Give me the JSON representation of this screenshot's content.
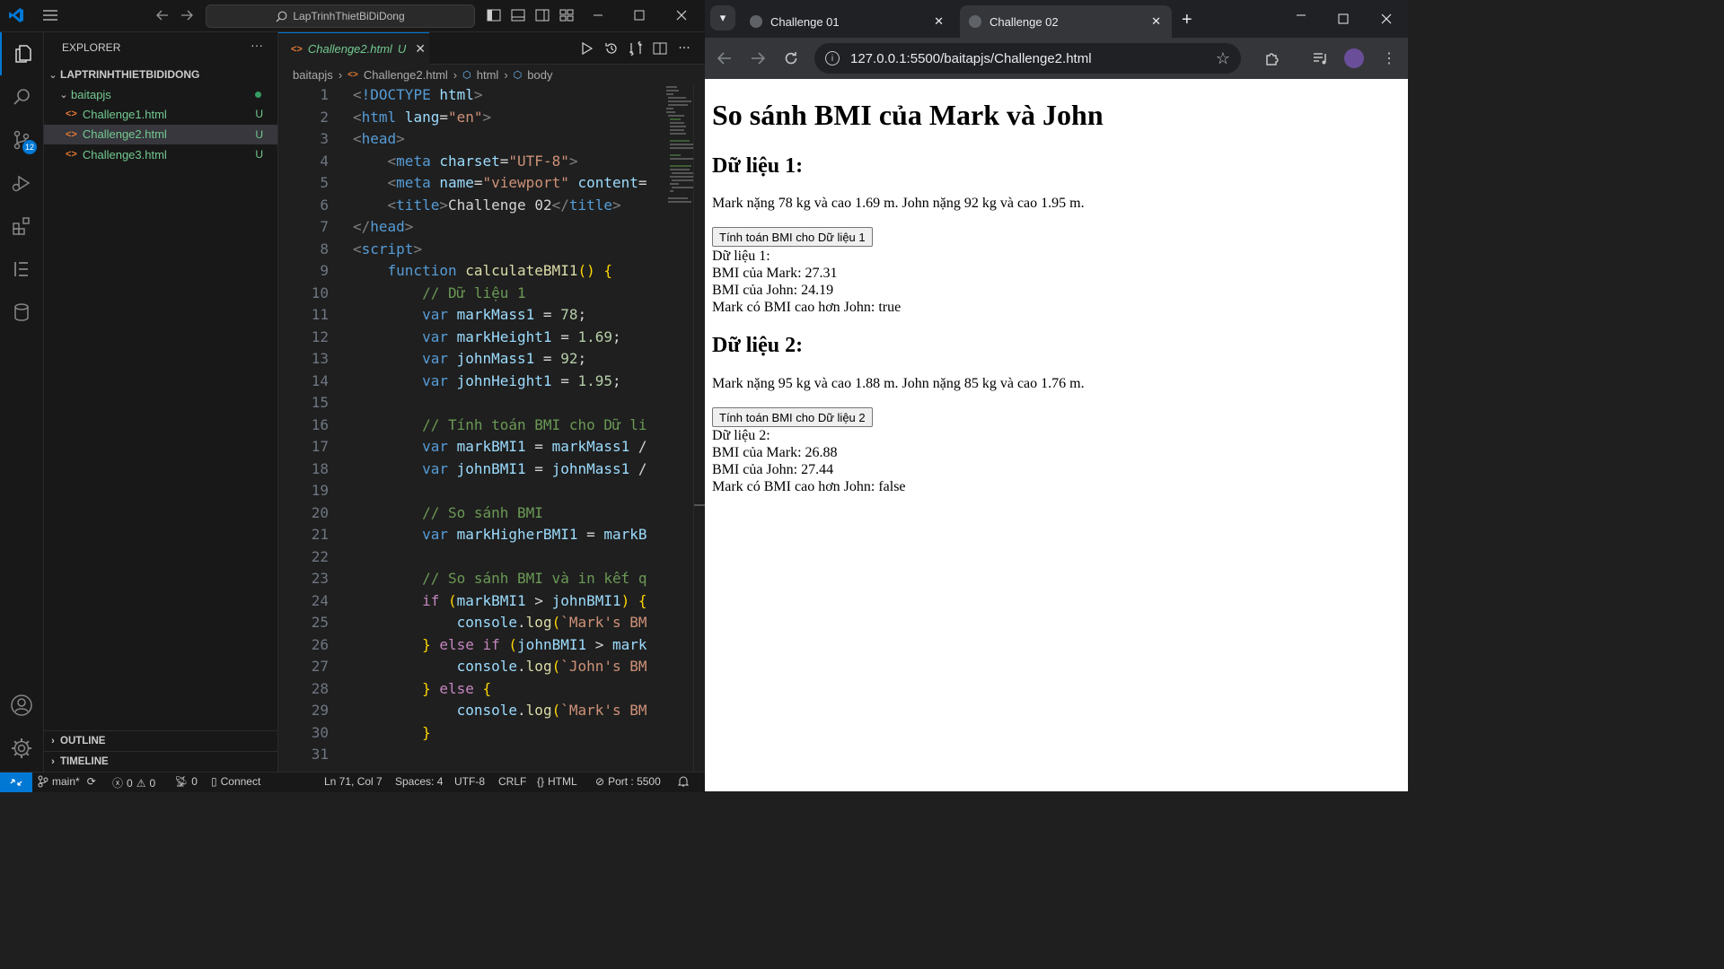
{
  "vscode": {
    "search_text": "LapTrinhThietBiDiDong",
    "explorer_title": "EXPLORER",
    "explorer_more": "···",
    "project_name": "LAPTRINHTHIETBIDIDONG",
    "folder_name": "baitapjs",
    "files": [
      {
        "name": "Challenge1.html",
        "status": "U",
        "selected": false
      },
      {
        "name": "Challenge2.html",
        "status": "U",
        "selected": true
      },
      {
        "name": "Challenge3.html",
        "status": "U",
        "selected": false
      }
    ],
    "outline_label": "OUTLINE",
    "timeline_label": "TIMELINE",
    "scm_badge": "12",
    "active_tab": {
      "name": "Challenge2.html",
      "status": "U"
    },
    "breadcrumb": [
      "baitapjs",
      "Challenge2.html",
      "html",
      "body"
    ],
    "code_lines": [
      [
        [
          "t-tag",
          "<"
        ],
        [
          "t-kw",
          "!DOCTYPE"
        ],
        [
          "t-attr",
          " html"
        ],
        [
          "t-tag",
          ">"
        ]
      ],
      [
        [
          "t-tag",
          "<"
        ],
        [
          "t-kw",
          "html"
        ],
        [
          "t-attr",
          " lang"
        ],
        [
          "t-txt",
          "="
        ],
        [
          "t-str",
          "\"en\""
        ],
        [
          "t-tag",
          ">"
        ]
      ],
      [
        [
          "t-tag",
          "<"
        ],
        [
          "t-kw",
          "head"
        ],
        [
          "t-tag",
          ">"
        ]
      ],
      [
        [
          "t-txt",
          "    "
        ],
        [
          "t-tag",
          "<"
        ],
        [
          "t-kw",
          "meta"
        ],
        [
          "t-attr",
          " charset"
        ],
        [
          "t-txt",
          "="
        ],
        [
          "t-str",
          "\"UTF-8\""
        ],
        [
          "t-tag",
          ">"
        ]
      ],
      [
        [
          "t-txt",
          "    "
        ],
        [
          "t-tag",
          "<"
        ],
        [
          "t-kw",
          "meta"
        ],
        [
          "t-attr",
          " name"
        ],
        [
          "t-txt",
          "="
        ],
        [
          "t-str",
          "\"viewport\""
        ],
        [
          "t-attr",
          " content"
        ],
        [
          "t-txt",
          "="
        ]
      ],
      [
        [
          "t-txt",
          "    "
        ],
        [
          "t-tag",
          "<"
        ],
        [
          "t-kw",
          "title"
        ],
        [
          "t-tag",
          ">"
        ],
        [
          "t-txt",
          "Challenge 02"
        ],
        [
          "t-tag",
          "</"
        ],
        [
          "t-kw",
          "title"
        ],
        [
          "t-tag",
          ">"
        ]
      ],
      [
        [
          "t-tag",
          "</"
        ],
        [
          "t-kw",
          "head"
        ],
        [
          "t-tag",
          ">"
        ]
      ],
      [
        [
          "t-tag",
          "<"
        ],
        [
          "t-kw",
          "script"
        ],
        [
          "t-tag",
          ">"
        ]
      ],
      [
        [
          "t-txt",
          "    "
        ],
        [
          "t-kw",
          "function"
        ],
        [
          "t-fn",
          " calculateBMI1"
        ],
        [
          "t-br",
          "()"
        ],
        [
          "t-txt",
          " "
        ],
        [
          "t-br",
          "{"
        ]
      ],
      [
        [
          "t-txt",
          "        "
        ],
        [
          "t-com",
          "// Dữ liệu 1"
        ]
      ],
      [
        [
          "t-txt",
          "        "
        ],
        [
          "t-kw",
          "var"
        ],
        [
          "t-var",
          " markMass1"
        ],
        [
          "t-txt",
          " = "
        ],
        [
          "t-num",
          "78"
        ],
        [
          "t-txt",
          ";"
        ]
      ],
      [
        [
          "t-txt",
          "        "
        ],
        [
          "t-kw",
          "var"
        ],
        [
          "t-var",
          " markHeight1"
        ],
        [
          "t-txt",
          " = "
        ],
        [
          "t-num",
          "1.69"
        ],
        [
          "t-txt",
          ";"
        ]
      ],
      [
        [
          "t-txt",
          "        "
        ],
        [
          "t-kw",
          "var"
        ],
        [
          "t-var",
          " johnMass1"
        ],
        [
          "t-txt",
          " = "
        ],
        [
          "t-num",
          "92"
        ],
        [
          "t-txt",
          ";"
        ]
      ],
      [
        [
          "t-txt",
          "        "
        ],
        [
          "t-kw",
          "var"
        ],
        [
          "t-var",
          " johnHeight1"
        ],
        [
          "t-txt",
          " = "
        ],
        [
          "t-num",
          "1.95"
        ],
        [
          "t-txt",
          ";"
        ]
      ],
      [],
      [
        [
          "t-txt",
          "        "
        ],
        [
          "t-com",
          "// Tính toán BMI cho Dữ li"
        ]
      ],
      [
        [
          "t-txt",
          "        "
        ],
        [
          "t-kw",
          "var"
        ],
        [
          "t-var",
          " markBMI1"
        ],
        [
          "t-txt",
          " = "
        ],
        [
          "t-var",
          "markMass1"
        ],
        [
          "t-txt",
          " /"
        ]
      ],
      [
        [
          "t-txt",
          "        "
        ],
        [
          "t-kw",
          "var"
        ],
        [
          "t-var",
          " johnBMI1"
        ],
        [
          "t-txt",
          " = "
        ],
        [
          "t-var",
          "johnMass1"
        ],
        [
          "t-txt",
          " /"
        ]
      ],
      [],
      [
        [
          "t-txt",
          "        "
        ],
        [
          "t-com",
          "// So sánh BMI"
        ]
      ],
      [
        [
          "t-txt",
          "        "
        ],
        [
          "t-kw",
          "var"
        ],
        [
          "t-var",
          " markHigherBMI1"
        ],
        [
          "t-txt",
          " = "
        ],
        [
          "t-var",
          "markB"
        ]
      ],
      [],
      [
        [
          "t-txt",
          "        "
        ],
        [
          "t-com",
          "// So sánh BMI và in kết q"
        ]
      ],
      [
        [
          "t-txt",
          "        "
        ],
        [
          "t-ctl",
          "if"
        ],
        [
          "t-txt",
          " "
        ],
        [
          "t-br",
          "("
        ],
        [
          "t-var",
          "markBMI1"
        ],
        [
          "t-txt",
          " > "
        ],
        [
          "t-var",
          "johnBMI1"
        ],
        [
          "t-br",
          ")"
        ],
        [
          "t-txt",
          " "
        ],
        [
          "t-br",
          "{"
        ]
      ],
      [
        [
          "t-txt",
          "            "
        ],
        [
          "t-var",
          "console"
        ],
        [
          "t-txt",
          "."
        ],
        [
          "t-fn",
          "log"
        ],
        [
          "t-br",
          "("
        ],
        [
          "t-str",
          "`Mark's BM"
        ]
      ],
      [
        [
          "t-txt",
          "        "
        ],
        [
          "t-br",
          "}"
        ],
        [
          "t-ctl",
          " else if"
        ],
        [
          "t-txt",
          " "
        ],
        [
          "t-br",
          "("
        ],
        [
          "t-var",
          "johnBMI1"
        ],
        [
          "t-txt",
          " > "
        ],
        [
          "t-var",
          "mark"
        ]
      ],
      [
        [
          "t-txt",
          "            "
        ],
        [
          "t-var",
          "console"
        ],
        [
          "t-txt",
          "."
        ],
        [
          "t-fn",
          "log"
        ],
        [
          "t-br",
          "("
        ],
        [
          "t-str",
          "`John's BM"
        ]
      ],
      [
        [
          "t-txt",
          "        "
        ],
        [
          "t-br",
          "}"
        ],
        [
          "t-ctl",
          " else"
        ],
        [
          "t-txt",
          " "
        ],
        [
          "t-br",
          "{"
        ]
      ],
      [
        [
          "t-txt",
          "            "
        ],
        [
          "t-var",
          "console"
        ],
        [
          "t-txt",
          "."
        ],
        [
          "t-fn",
          "log"
        ],
        [
          "t-br",
          "("
        ],
        [
          "t-str",
          "`Mark's BM"
        ]
      ],
      [
        [
          "t-txt",
          "        "
        ],
        [
          "t-br",
          "}"
        ]
      ],
      []
    ],
    "status": {
      "branch": "main*",
      "errors": "0",
      "warnings": "0",
      "ports": "0",
      "connect": "Connect",
      "position": "Ln 71, Col 7",
      "spaces": "Spaces: 4",
      "encoding": "UTF-8",
      "eol": "CRLF",
      "language": "HTML",
      "port": "Port : 5500"
    },
    "accent": "#0078d4"
  },
  "browser": {
    "tabs": [
      {
        "title": "Challenge 01",
        "active": false
      },
      {
        "title": "Challenge 02",
        "active": true
      }
    ],
    "url": "127.0.0.1:5500/baitapjs/Challenge2.html",
    "page": {
      "title": "So sánh BMI của Mark và John",
      "data1": {
        "heading": "Dữ liệu 1:",
        "desc": "Mark nặng 78 kg và cao 1.69 m. John nặng 92 kg và cao 1.95 m.",
        "button": "Tính toán BMI cho Dữ liệu 1",
        "results": [
          "Dữ liệu 1:",
          "BMI của Mark: 27.31",
          "BMI của John: 24.19",
          "Mark có BMI cao hơn John: true"
        ]
      },
      "data2": {
        "heading": "Dữ liệu 2:",
        "desc": "Mark nặng 95 kg và cao 1.88 m. John nặng 85 kg và cao 1.76 m.",
        "button": "Tính toán BMI cho Dữ liệu 2",
        "results": [
          "Dữ liệu 2:",
          "BMI của Mark: 26.88",
          "BMI của John: 27.44",
          "Mark có BMI cao hơn John: false"
        ]
      }
    }
  }
}
